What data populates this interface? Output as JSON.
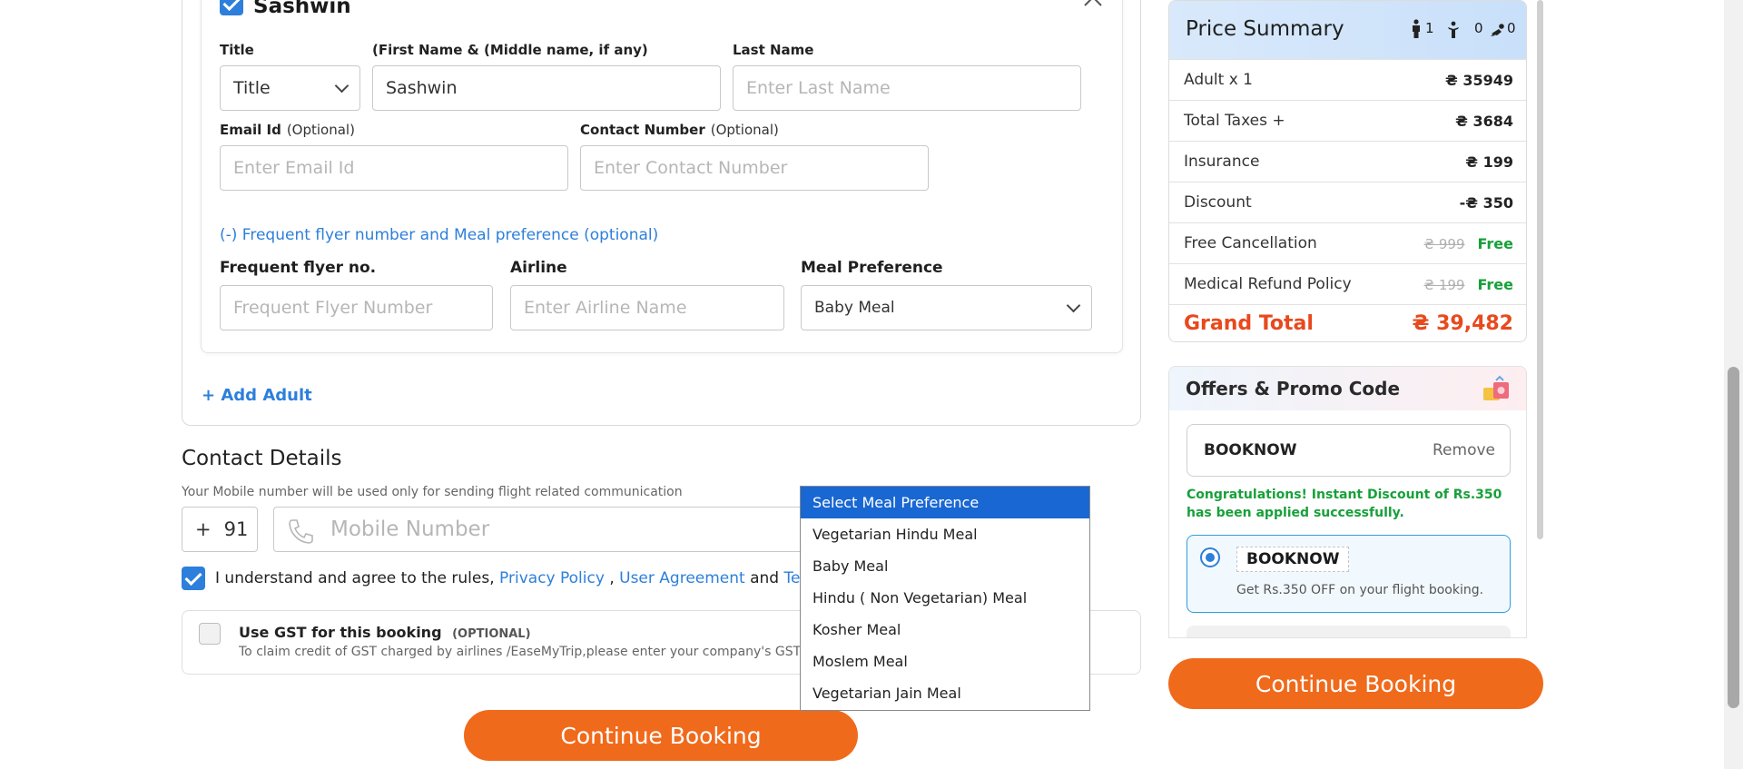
{
  "traveller": {
    "name": "Sashwin",
    "title_label": "Title",
    "title_value": "Title",
    "first_label": "(First Name & (Middle name, if any)",
    "first_value": "Sashwin",
    "last_label": "Last Name",
    "last_placeholder": "Enter Last Name",
    "email_label": "Email Id",
    "email_optional": "(Optional)",
    "email_placeholder": "Enter Email Id",
    "contact_label": "Contact Number",
    "contact_optional": "(Optional)",
    "contact_placeholder": "Enter Contact Number",
    "ff_toggle": "(-) Frequent flyer number and Meal preference (optional)",
    "ff_label": "Frequent flyer no.",
    "ff_placeholder": "Frequent Flyer Number",
    "airline_label": "Airline",
    "airline_placeholder": "Enter Airline Name",
    "meal_label": "Meal Preference",
    "meal_value": "Baby Meal",
    "add_adult": "+ Add Adult"
  },
  "meal_options": [
    "Select Meal Preference",
    "Vegetarian Hindu Meal",
    "Baby Meal",
    "Hindu ( Non Vegetarian) Meal",
    "Kosher Meal",
    "Moslem Meal",
    "Vegetarian Jain Meal"
  ],
  "contact": {
    "title": "Contact Details",
    "subtitle": "Your Mobile number will be used only for sending flight related communication",
    "plus": "+",
    "code": "91",
    "mobile_placeholder": "Mobile Number",
    "agree_text": "I understand and agree to the rules,",
    "privacy": "Privacy Policy",
    "comma": ",",
    "user_agreement": "User Agreement",
    "and": "and",
    "terms": "Terms",
    "gst_title": "Use GST for this booking",
    "gst_optional": "(OPTIONAL)",
    "gst_desc": "To claim credit of GST charged by airlines /EaseMyTrip,please enter your company's GST nu"
  },
  "continue_label": "Continue Booking",
  "price_summary": {
    "title": "Price Summary",
    "adults": "1",
    "children": "0",
    "infants": "0",
    "rows": [
      {
        "label": "Adult x 1",
        "value": "₴ 35949"
      },
      {
        "label": "Total Taxes +",
        "value": "₴ 3684"
      },
      {
        "label": "Insurance",
        "value": "₴ 199"
      },
      {
        "label": "Discount",
        "value": "-₴ 350"
      },
      {
        "label": "Free Cancellation",
        "old": "₴ 999",
        "value": "Free"
      },
      {
        "label": "Medical Refund Policy",
        "old": "₴ 199",
        "value": "Free"
      }
    ],
    "grand_label": "Grand Total",
    "grand_value": "₴ 39,482"
  },
  "offers": {
    "title": "Offers & Promo Code",
    "code": "BOOKNOW",
    "remove": "Remove",
    "success": "Congratulations! Instant Discount of Rs.350 has been applied successfully.",
    "option_code": "BOOKNOW",
    "option_desc": "Get Rs.350 OFF on your flight booking."
  },
  "colors": {
    "accent_blue": "#2d7fdb",
    "orange": "#f06a1b",
    "grand_total": "#e8491d",
    "green": "#18a03a"
  }
}
